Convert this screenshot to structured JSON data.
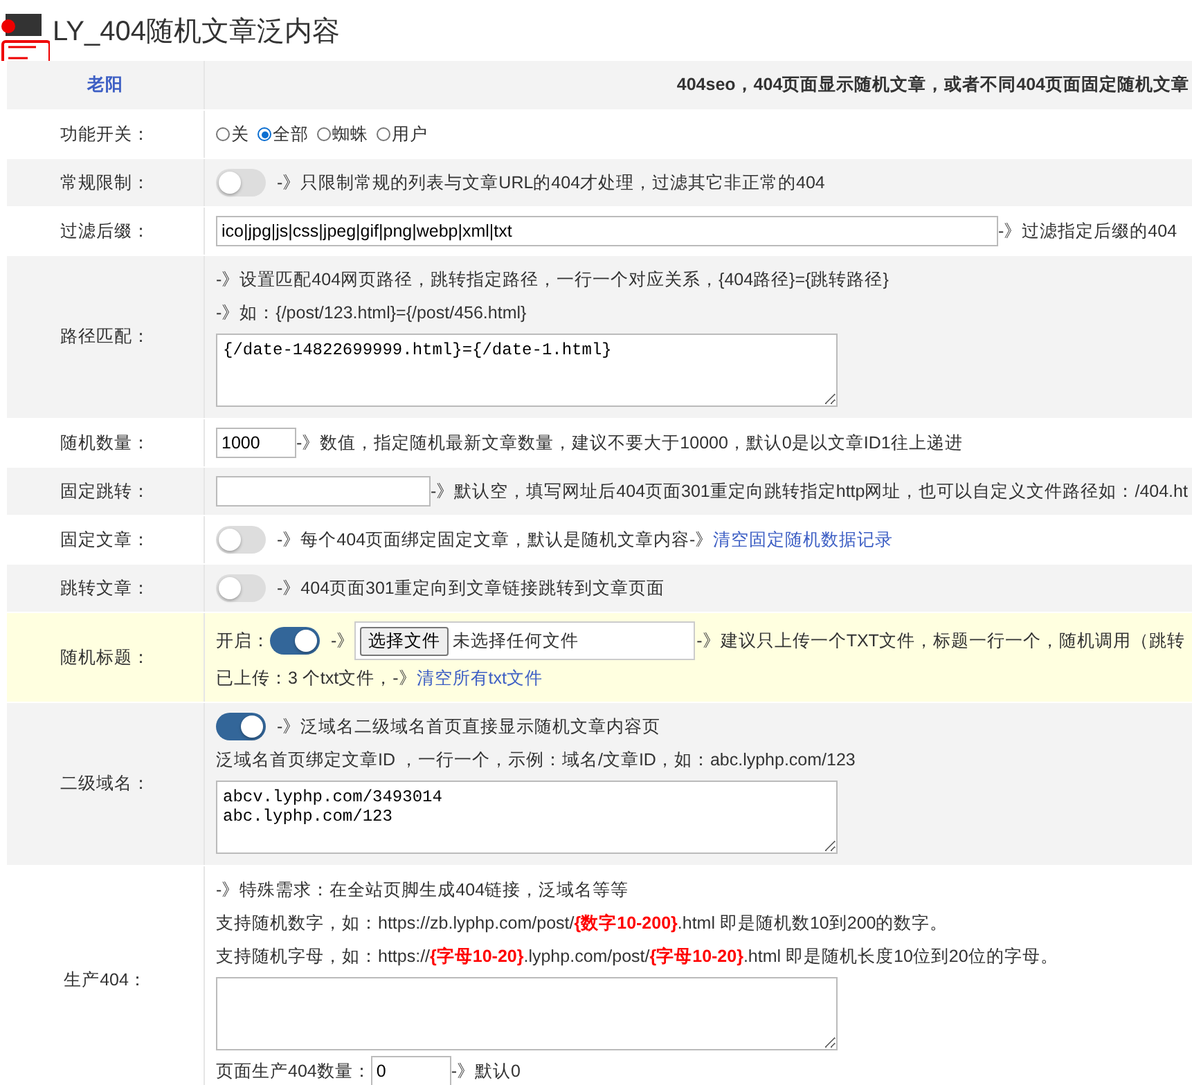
{
  "title": "LY_404随机文章泛内容",
  "header": {
    "label": "老阳",
    "text": "404seo，404页面显示随机文章，或者不同404页面固定随机文章"
  },
  "rows": [
    {
      "label": "功能开关：",
      "lines": [
        {
          "items": [
            {
              "kind": "radio",
              "label": "关",
              "selected": false
            },
            {
              "kind": "radio",
              "label": "全部",
              "selected": true
            },
            {
              "kind": "radio",
              "label": "蜘蛛",
              "selected": false
            },
            {
              "kind": "radio",
              "label": "用户",
              "selected": false
            }
          ]
        }
      ]
    },
    {
      "label": "常规限制：",
      "lines": [
        {
          "items": [
            {
              "kind": "toggle",
              "on": false
            },
            {
              "kind": "text",
              "text": "-》只限制常规的列表与文章URL的404才处理，过滤其它非正常的404"
            }
          ]
        }
      ]
    },
    {
      "label": "过滤后缀：",
      "lines": [
        {
          "items": [
            {
              "kind": "input-long",
              "value": "ico|jpg|js|css|jpeg|gif|png|webp|xml|txt"
            },
            {
              "kind": "text",
              "text": "-》过滤指定后缀的404"
            }
          ]
        }
      ]
    },
    {
      "label": "路径匹配：",
      "lines": [
        {
          "items": [
            {
              "kind": "text",
              "text": "-》设置匹配404网页路径，跳转指定路径，一行一个对应关系，{404路径}={跳转路径}"
            }
          ]
        },
        {
          "items": [
            {
              "kind": "text",
              "text": "-》如：{/post/123.html}={/post/456.html}"
            }
          ]
        },
        {
          "items": [
            {
              "kind": "textarea",
              "value": "{/date-14822699999.html}={/date-1.html}"
            }
          ]
        }
      ]
    },
    {
      "label": "随机数量：",
      "lines": [
        {
          "items": [
            {
              "kind": "input-short",
              "value": "1000"
            },
            {
              "kind": "text",
              "text": "-》数值，指定随机最新文章数量，建议不要大于10000，默认0是以文章ID1往上递进"
            }
          ]
        }
      ]
    },
    {
      "label": "固定跳转：",
      "lines": [
        {
          "items": [
            {
              "kind": "input-medium"
            },
            {
              "kind": "text",
              "text": "-》默认空，填写网址后404页面301重定向跳转指定http网址，也可以自定义文件路径如：/404.ht"
            }
          ]
        }
      ]
    },
    {
      "label": "固定文章：",
      "lines": [
        {
          "items": [
            {
              "kind": "toggle",
              "on": false
            },
            {
              "kind": "text",
              "text": "-》每个404页面绑定固定文章，默认是随机文章内容-》"
            },
            {
              "kind": "link",
              "text": "清空固定随机数据记录"
            }
          ]
        }
      ]
    },
    {
      "label": "跳转文章：",
      "lines": [
        {
          "items": [
            {
              "kind": "toggle",
              "on": false
            },
            {
              "kind": "text",
              "text": "-》404页面301重定向到文章链接跳转到文章页面"
            }
          ]
        }
      ]
    },
    {
      "label": "随机标题：",
      "highlight": true,
      "lines": [
        {
          "items": [
            {
              "kind": "text",
              "text": "开启："
            },
            {
              "kind": "toggle",
              "on": true
            },
            {
              "kind": "text",
              "text": "-》"
            },
            {
              "kind": "file",
              "button": "选择文件",
              "status": "未选择任何文件"
            },
            {
              "kind": "text",
              "text": "-》建议只上传一个TXT文件，标题一行一个，随机调用（跳转"
            }
          ]
        },
        {
          "items": [
            {
              "kind": "text",
              "text": "已上传：3 个txt文件，-》"
            },
            {
              "kind": "link",
              "text": "清空所有txt文件"
            }
          ]
        }
      ]
    },
    {
      "label": "二级域名：",
      "lines": [
        {
          "items": [
            {
              "kind": "toggle",
              "on": true
            },
            {
              "kind": "text",
              "text": "-》泛域名二级域名首页直接显示随机文章内容页"
            }
          ]
        },
        {
          "items": [
            {
              "kind": "text",
              "text": "泛域名首页绑定文章ID ，一行一个，示例：域名/文章ID，如：abc.lyphp.com/123"
            }
          ]
        },
        {
          "items": [
            {
              "kind": "textarea",
              "value": "abcv.lyphp.com/3493014\nabc.lyphp.com/123"
            }
          ]
        }
      ]
    },
    {
      "label": "生产404：",
      "lines": [
        {
          "items": [
            {
              "kind": "text",
              "text": "-》特殊需求：在全站页脚生成404链接，泛域名等等"
            }
          ]
        },
        {
          "items": [
            {
              "kind": "text",
              "text": "支持随机数字，如：https://zb.lyphp.com/post/**{数字10-200}**.html 即是随机数10到200的数字。"
            }
          ]
        },
        {
          "items": [
            {
              "kind": "text",
              "text": "支持随机字母，如：https://**{字母10-20}**.lyphp.com/post/**{字母10-20}**.html 即是随机长度10位到20位的字母。"
            }
          ]
        },
        {
          "items": [
            {
              "kind": "textarea"
            }
          ]
        },
        {
          "items": [
            {
              "kind": "text",
              "text": "页面生产404数量："
            },
            {
              "kind": "input-short",
              "value": "0"
            },
            {
              "kind": "text",
              "text": "-》默认0"
            }
          ]
        }
      ]
    }
  ]
}
